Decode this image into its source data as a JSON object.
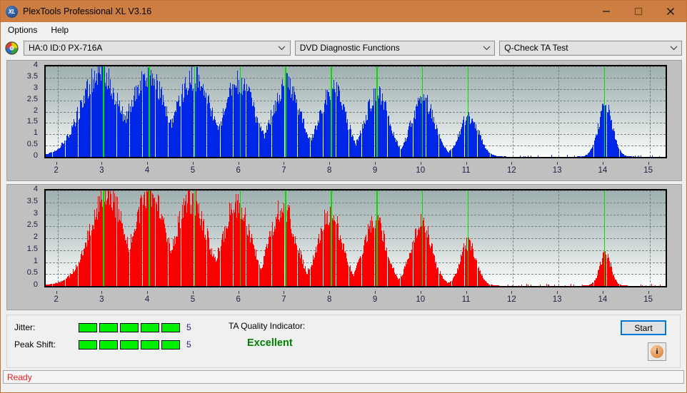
{
  "window": {
    "title": "PlexTools Professional XL V3.16",
    "app_icon": "XL",
    "minimize_label": "minimize-icon",
    "maximize_label": "maximize-icon",
    "close_label": "close-icon",
    "accent_color": "#cd7f43"
  },
  "menu": {
    "items": [
      {
        "label": "Options"
      },
      {
        "label": "Help"
      }
    ]
  },
  "toolbar": {
    "drive_icon": "disc-icon",
    "drive_select": {
      "value": "HA:0 ID:0  PX-716A"
    },
    "function_select": {
      "value": "DVD Diagnostic Functions"
    },
    "test_select": {
      "value": "Q-Check TA Test"
    }
  },
  "panel": {
    "jitter_label": "Jitter:",
    "jitter_value": "5",
    "jitter_segments": 5,
    "peak_shift_label": "Peak Shift:",
    "peak_shift_value": "5",
    "peak_shift_segments": 5,
    "segment_color": "#00f000",
    "ta_quality_label": "TA Quality Indicator:",
    "ta_quality_value": "Excellent",
    "ta_quality_color": "#008000",
    "start_label": "Start",
    "info_label": "i"
  },
  "statusbar": {
    "text": "Ready",
    "color": "#e02020"
  },
  "chart_data": [
    {
      "id": "jitter-chart",
      "type": "bar",
      "series_name": "Jitter",
      "color": "#0026e6",
      "marker_color": "#00e000",
      "title": "",
      "xlabel": "",
      "ylabel": "",
      "ylim": [
        0,
        4
      ],
      "xlim": [
        1.74,
        15.35
      ],
      "yticks": [
        0,
        0.5,
        1,
        1.5,
        2,
        2.5,
        3,
        3.5,
        4
      ],
      "ytick_labels": [
        "0",
        "0.5",
        "1",
        "1.5",
        "2",
        "2.5",
        "3",
        "3.5",
        "4"
      ],
      "xticks": [
        2,
        3,
        4,
        5,
        6,
        7,
        8,
        9,
        10,
        11,
        12,
        13,
        14,
        15
      ],
      "xtick_labels": [
        "2",
        "3",
        "4",
        "5",
        "6",
        "7",
        "8",
        "9",
        "10",
        "11",
        "12",
        "13",
        "14",
        "15"
      ],
      "grid": true,
      "markers": [
        3,
        4,
        5,
        6,
        7,
        8,
        9,
        10,
        11,
        14
      ],
      "bar_width": 0.0115,
      "bar_step": 0.0166,
      "peaks": [
        {
          "center": 2.93,
          "height": 3.72,
          "half_width": 0.62,
          "shoulder": 0.16,
          "floor": 0.0
        },
        {
          "center": 3.97,
          "height": 3.68,
          "half_width": 0.56,
          "shoulder": 0.14,
          "floor": 0.0
        },
        {
          "center": 4.98,
          "height": 3.52,
          "half_width": 0.55,
          "shoulder": 0.12,
          "floor": 0.0
        },
        {
          "center": 5.99,
          "height": 3.34,
          "half_width": 0.5,
          "shoulder": 0.1,
          "floor": 0.0
        },
        {
          "center": 7.02,
          "height": 3.18,
          "half_width": 0.46,
          "shoulder": 0.1,
          "floor": 0.0
        },
        {
          "center": 8.03,
          "height": 2.98,
          "half_width": 0.43,
          "shoulder": 0.08,
          "floor": 0.0
        },
        {
          "center": 9.01,
          "height": 2.78,
          "half_width": 0.39,
          "shoulder": 0.07,
          "floor": 0.0
        },
        {
          "center": 10.02,
          "height": 2.58,
          "half_width": 0.38,
          "shoulder": 0.06,
          "floor": 0.0
        },
        {
          "center": 11.03,
          "height": 1.78,
          "half_width": 0.31,
          "shoulder": 0.05,
          "floor": 0.0
        },
        {
          "center": 14.02,
          "height": 2.22,
          "half_width": 0.24,
          "shoulder": 0.04,
          "floor": 0.0
        }
      ]
    },
    {
      "id": "peak-shift-chart",
      "type": "bar",
      "series_name": "Peak Shift",
      "color": "#fa0000",
      "marker_color": "#00e000",
      "title": "",
      "xlabel": "",
      "ylabel": "",
      "ylim": [
        0,
        4
      ],
      "xlim": [
        1.74,
        15.35
      ],
      "yticks": [
        0,
        0.5,
        1,
        1.5,
        2,
        2.5,
        3,
        3.5,
        4
      ],
      "ytick_labels": [
        "0",
        "0.5",
        "1",
        "1.5",
        "2",
        "2.5",
        "3",
        "3.5",
        "4"
      ],
      "xticks": [
        2,
        3,
        4,
        5,
        6,
        7,
        8,
        9,
        10,
        11,
        12,
        13,
        14,
        15
      ],
      "xtick_labels": [
        "2",
        "3",
        "4",
        "5",
        "6",
        "7",
        "8",
        "9",
        "10",
        "11",
        "12",
        "13",
        "14",
        "15"
      ],
      "grid": true,
      "markers": [
        3,
        4,
        5,
        6,
        7,
        8,
        9,
        10,
        11,
        14
      ],
      "bar_width": 0.0095,
      "bar_step": 0.0166,
      "peaks": [
        {
          "center": 3.08,
          "height": 3.78,
          "half_width": 0.56,
          "shoulder": 0.22,
          "floor": 0.06
        },
        {
          "center": 4.02,
          "height": 3.7,
          "half_width": 0.52,
          "shoulder": 0.2,
          "floor": 0.06
        },
        {
          "center": 4.93,
          "height": 3.56,
          "half_width": 0.49,
          "shoulder": 0.18,
          "floor": 0.05
        },
        {
          "center": 5.93,
          "height": 3.38,
          "half_width": 0.45,
          "shoulder": 0.16,
          "floor": 0.05
        },
        {
          "center": 6.94,
          "height": 3.24,
          "half_width": 0.42,
          "shoulder": 0.14,
          "floor": 0.05
        },
        {
          "center": 7.97,
          "height": 3.04,
          "half_width": 0.39,
          "shoulder": 0.12,
          "floor": 0.04
        },
        {
          "center": 8.96,
          "height": 2.82,
          "half_width": 0.36,
          "shoulder": 0.1,
          "floor": 0.04
        },
        {
          "center": 9.98,
          "height": 2.62,
          "half_width": 0.34,
          "shoulder": 0.09,
          "floor": 0.04
        },
        {
          "center": 11.01,
          "height": 1.78,
          "half_width": 0.26,
          "shoulder": 0.07,
          "floor": 0.03
        },
        {
          "center": 14.02,
          "height": 1.28,
          "half_width": 0.19,
          "shoulder": 0.04,
          "floor": 0.02
        }
      ]
    }
  ]
}
